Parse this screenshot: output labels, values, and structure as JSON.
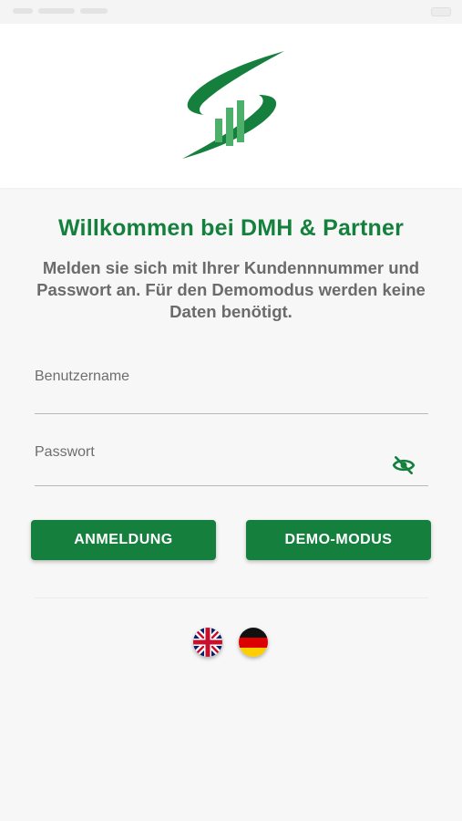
{
  "app": {
    "logo_icon": "dmh-partner-logo",
    "accent_color": "#15803d"
  },
  "welcome": {
    "title": "Willkommen bei DMH & Partner",
    "subtitle": "Melden sie sich mit Ihrer Kundennnummer und Passwort an. Für den Demomodus werden keine Daten benötigt."
  },
  "form": {
    "username_label": "Benutzername",
    "username_value": "",
    "password_label": "Passwort",
    "password_value": "",
    "password_toggle_icon": "eye-off-icon"
  },
  "buttons": {
    "login_label": "ANMELDUNG",
    "demo_label": "DEMO-MODUS"
  },
  "languages": [
    {
      "code": "en",
      "icon": "uk-flag-icon"
    },
    {
      "code": "de",
      "icon": "germany-flag-icon"
    }
  ]
}
